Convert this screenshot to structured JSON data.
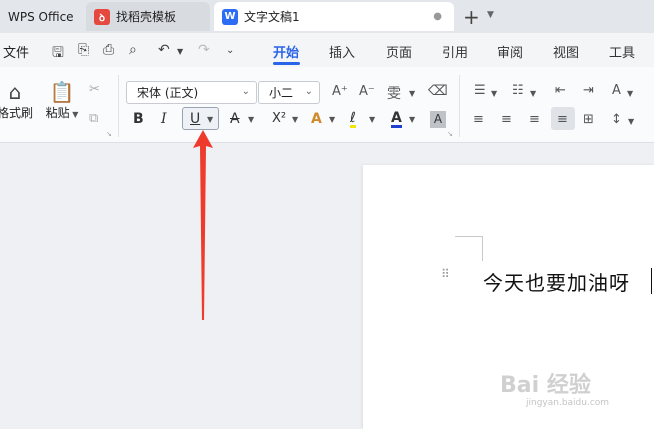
{
  "tabs": {
    "app": "WPS Office",
    "template": "找稻壳模板",
    "document": "文字文稿1",
    "template_icon": "daoke-icon",
    "document_icon": "word-icon",
    "add": "+"
  },
  "menu": {
    "file": "文件",
    "tabs": [
      "开始",
      "插入",
      "页面",
      "引用",
      "审阅",
      "视图",
      "工具"
    ],
    "active_tab": "开始"
  },
  "ribbon": {
    "format_painter": "格式刷",
    "paste": "粘贴",
    "font_name": "宋体 (正文)",
    "font_size": "小二",
    "bold": "B",
    "italic": "I",
    "underline": "U",
    "superscript": "X²",
    "font_grow": "A⁺",
    "font_shrink": "A⁻",
    "pinyin": "雯",
    "text_effect": "A",
    "highlight": "ℓ",
    "font_color": "A",
    "char_shade": "A"
  },
  "document": {
    "text": "今天也要加油呀"
  },
  "watermark": {
    "logo": "Bai 经验",
    "url": "jingyan.baidu.com"
  },
  "colors": {
    "accent": "#2a64e8",
    "arrow": "#ee3b2b",
    "highlight_yellow": "#f5e50b",
    "font_color_blue": "#1f3fd1"
  }
}
